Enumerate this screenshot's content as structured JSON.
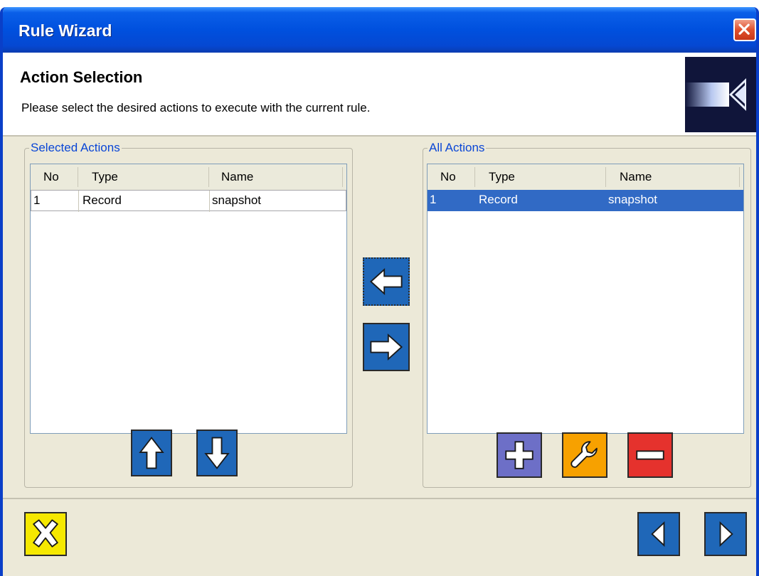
{
  "window": {
    "title": "Rule Wizard"
  },
  "header": {
    "title": "Action Selection",
    "subtitle": "Please select the desired actions to execute with the current rule."
  },
  "selected_actions": {
    "legend": "Selected Actions",
    "columns": [
      "No",
      "Type",
      "Name"
    ],
    "rows": [
      {
        "no": "1",
        "type": "Record",
        "name": "snapshot"
      }
    ]
  },
  "all_actions": {
    "legend": "All Actions",
    "columns": [
      "No",
      "Type",
      "Name"
    ],
    "rows": [
      {
        "no": "1",
        "type": "Record",
        "name": "snapshot",
        "selected": true
      }
    ]
  },
  "icons": {
    "close": "close-icon",
    "move_left": "arrow-left-icon",
    "move_right": "arrow-right-icon",
    "move_up": "arrow-up-icon",
    "move_down": "arrow-down-icon",
    "add": "plus-icon",
    "edit": "wrench-icon",
    "remove": "minus-icon",
    "cancel": "x-icon",
    "back": "triangle-left-icon",
    "next": "triangle-right-icon"
  },
  "colors": {
    "titlebar": "#0050de",
    "legend": "#0a46d6",
    "selection": "#316ac5",
    "nav_button": "#1f67b8",
    "add_button": "#6d6fc7",
    "edit_button": "#f7a100",
    "remove_button": "#e5322d",
    "cancel_button": "#f5e800"
  }
}
